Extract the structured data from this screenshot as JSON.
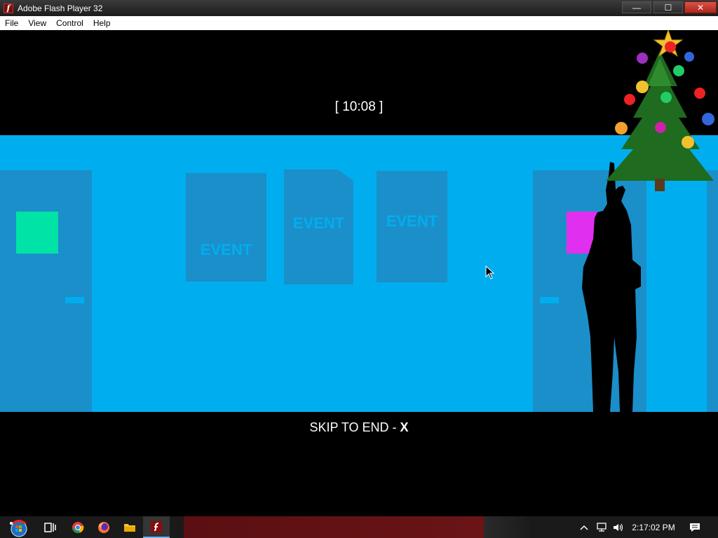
{
  "window": {
    "title": "Adobe Flash Player 32",
    "minimize_label": "—",
    "maximize_label": "☐",
    "close_label": "✕"
  },
  "menu": {
    "items": [
      "File",
      "View",
      "Control",
      "Help"
    ]
  },
  "game": {
    "timer": "[ 10:08 ]",
    "posters": [
      "EVENT",
      "EVENT",
      "EVENT"
    ],
    "skip_text": "SKIP TO END - ",
    "skip_key": "X"
  },
  "taskbar": {
    "icons": [
      "start-orb-icon",
      "task-view-icon",
      "chrome-icon",
      "firefox-icon",
      "file-explorer-icon",
      "flash-player-icon"
    ],
    "clock": "2:17:02 PM"
  },
  "colors": {
    "scene_bg": "#00aeef",
    "door": "#1b8fc9",
    "green_window": "#00e3a6",
    "magenta_window": "#e12ff0"
  }
}
